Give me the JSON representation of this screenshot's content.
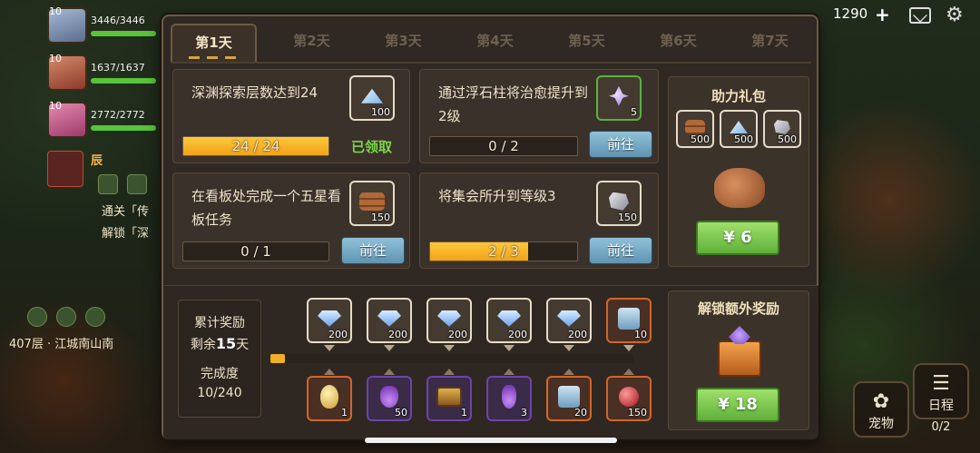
{
  "hud": {
    "heroes": [
      {
        "level": "10",
        "hp": "3446/3446"
      },
      {
        "level": "10",
        "hp": "1637/1637"
      },
      {
        "level": "10",
        "hp": "2772/2772"
      }
    ],
    "left_badge": "辰",
    "left_hint_1": "通关「传",
    "left_hint_2": "解锁「深",
    "location": "407层 · 江城南山南",
    "gold": "1290",
    "pet_label": "宠物",
    "schedule_label": "日程",
    "schedule_count": "0/2"
  },
  "tabs": [
    "第1天",
    "第2天",
    "第3天",
    "第4天",
    "第5天",
    "第6天",
    "第7天"
  ],
  "active_tab": 0,
  "tasks": [
    {
      "text": "深渊探索层数达到24",
      "reward_icon": "crystal-shard-icon",
      "reward_count": "100",
      "progress": "24 / 24",
      "progress_ratio": 1.0,
      "status": "已领取"
    },
    {
      "text": "通过浮石柱将治愈提升到2级",
      "reward_icon": "purple-crystal-icon",
      "reward_count": "5",
      "progress": "0 / 2",
      "progress_ratio": 0.0,
      "button": "前往"
    },
    {
      "text": "在看板处完成一个五星看板任务",
      "reward_icon": "wood-log-icon",
      "reward_count": "150",
      "progress": "0 / 1",
      "progress_ratio": 0.0,
      "button": "前往"
    },
    {
      "text": "将集会所升到等级3",
      "reward_icon": "stone-ore-icon",
      "reward_count": "150",
      "progress": "2 / 3",
      "progress_ratio": 0.667,
      "button": "前往"
    }
  ],
  "assist_pack": {
    "title": "助力礼包",
    "items": [
      {
        "icon": "wood-log-icon",
        "count": "500"
      },
      {
        "icon": "crystal-shard-icon",
        "count": "500"
      },
      {
        "icon": "stone-ore-icon",
        "count": "500"
      }
    ],
    "price": "¥ 6"
  },
  "cumulative": {
    "title": "累计奖励",
    "remaining_prefix": "剩余",
    "remaining_days": "15",
    "remaining_suffix": "天",
    "completion_label": "完成度",
    "completion_value": "10/240",
    "progress_ratio": 0.04,
    "top_rewards": [
      {
        "icon": "diamond-icon",
        "count": "200"
      },
      {
        "icon": "diamond-icon",
        "count": "200"
      },
      {
        "icon": "diamond-icon",
        "count": "200"
      },
      {
        "icon": "diamond-icon",
        "count": "200"
      },
      {
        "icon": "diamond-icon",
        "count": "200"
      },
      {
        "icon": "scroll-icon",
        "count": "10"
      }
    ],
    "bottom_rewards": [
      {
        "icon": "golden-egg-icon",
        "count": "1"
      },
      {
        "icon": "potion-icon",
        "count": "50"
      },
      {
        "icon": "treasure-chest-icon",
        "count": "1"
      },
      {
        "icon": "potion-icon",
        "count": "3"
      },
      {
        "icon": "scroll-icon",
        "count": "20"
      },
      {
        "icon": "red-orb-icon",
        "count": "150"
      }
    ]
  },
  "unlock_pack": {
    "title": "解锁额外奖励",
    "price": "¥ 18"
  }
}
